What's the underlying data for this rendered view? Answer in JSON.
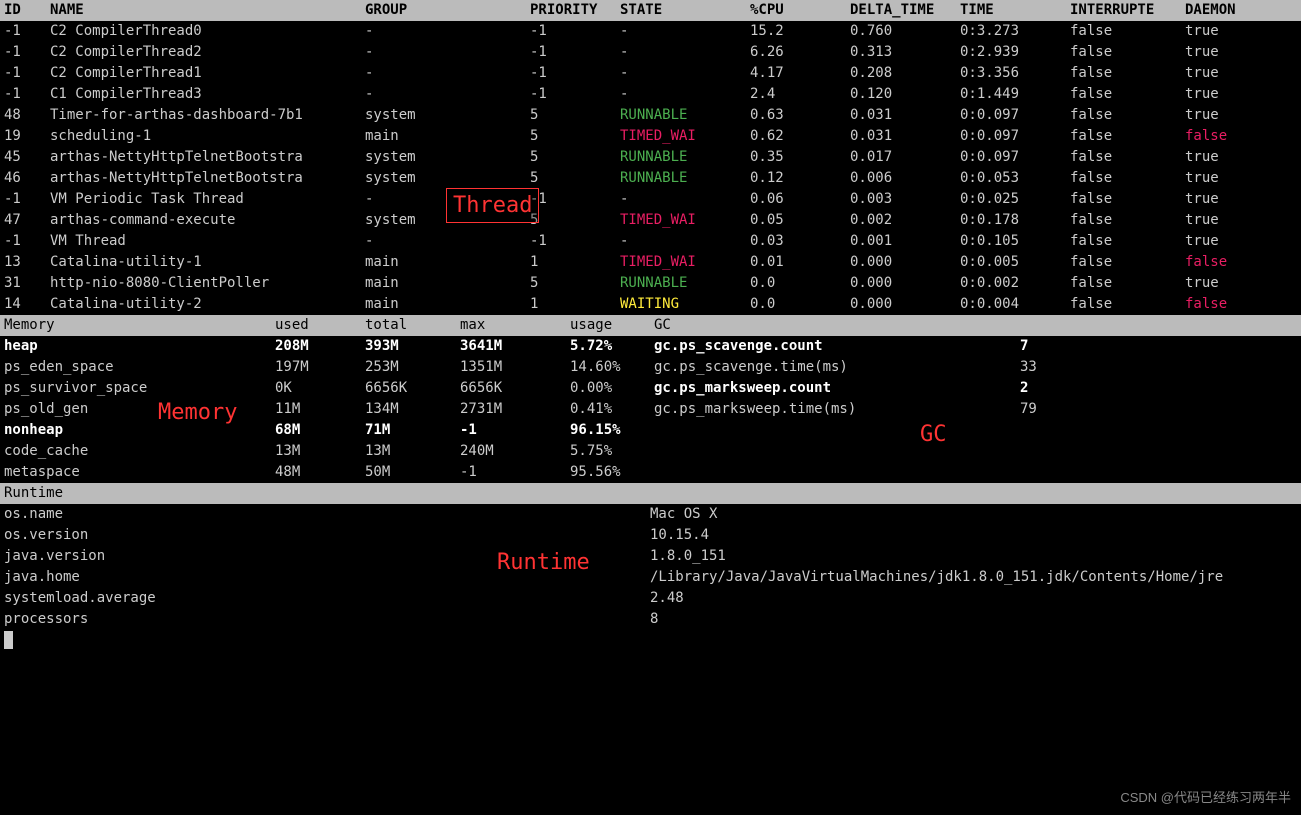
{
  "thread_headers": [
    "ID",
    "NAME",
    "GROUP",
    "PRIORITY",
    "STATE",
    "%CPU",
    "DELTA_TIME",
    "TIME",
    "INTERRUPTE",
    "DAEMON"
  ],
  "threads": [
    {
      "id": "-1",
      "name": "C2 CompilerThread0",
      "group": "-",
      "priority": "-1",
      "state": "-",
      "cpu": "15.2",
      "delta": "0.760",
      "time": "0:3.273",
      "interrupted": "false",
      "daemon": "true"
    },
    {
      "id": "-1",
      "name": "C2 CompilerThread2",
      "group": "-",
      "priority": "-1",
      "state": "-",
      "cpu": "6.26",
      "delta": "0.313",
      "time": "0:2.939",
      "interrupted": "false",
      "daemon": "true"
    },
    {
      "id": "-1",
      "name": "C2 CompilerThread1",
      "group": "-",
      "priority": "-1",
      "state": "-",
      "cpu": "4.17",
      "delta": "0.208",
      "time": "0:3.356",
      "interrupted": "false",
      "daemon": "true"
    },
    {
      "id": "-1",
      "name": "C1 CompilerThread3",
      "group": "-",
      "priority": "-1",
      "state": "-",
      "cpu": "2.4",
      "delta": "0.120",
      "time": "0:1.449",
      "interrupted": "false",
      "daemon": "true"
    },
    {
      "id": "48",
      "name": "Timer-for-arthas-dashboard-7b1",
      "group": "system",
      "priority": "5",
      "state": "RUNNABLE",
      "cpu": "0.63",
      "delta": "0.031",
      "time": "0:0.097",
      "interrupted": "false",
      "daemon": "true"
    },
    {
      "id": "19",
      "name": "scheduling-1",
      "group": "main",
      "priority": "5",
      "state": "TIMED_WAI",
      "cpu": "0.62",
      "delta": "0.031",
      "time": "0:0.097",
      "interrupted": "false",
      "daemon": "false"
    },
    {
      "id": "45",
      "name": "arthas-NettyHttpTelnetBootstra",
      "group": "system",
      "priority": "5",
      "state": "RUNNABLE",
      "cpu": "0.35",
      "delta": "0.017",
      "time": "0:0.097",
      "interrupted": "false",
      "daemon": "true"
    },
    {
      "id": "46",
      "name": "arthas-NettyHttpTelnetBootstra",
      "group": "system",
      "priority": "5",
      "state": "RUNNABLE",
      "cpu": "0.12",
      "delta": "0.006",
      "time": "0:0.053",
      "interrupted": "false",
      "daemon": "true"
    },
    {
      "id": "-1",
      "name": "VM Periodic Task Thread",
      "group": "-",
      "priority": "-1",
      "state": "-",
      "cpu": "0.06",
      "delta": "0.003",
      "time": "0:0.025",
      "interrupted": "false",
      "daemon": "true"
    },
    {
      "id": "47",
      "name": "arthas-command-execute",
      "group": "system",
      "priority": "5",
      "state": "TIMED_WAI",
      "cpu": "0.05",
      "delta": "0.002",
      "time": "0:0.178",
      "interrupted": "false",
      "daemon": "true"
    },
    {
      "id": "-1",
      "name": "VM Thread",
      "group": "-",
      "priority": "-1",
      "state": "-",
      "cpu": "0.03",
      "delta": "0.001",
      "time": "0:0.105",
      "interrupted": "false",
      "daemon": "true"
    },
    {
      "id": "13",
      "name": "Catalina-utility-1",
      "group": "main",
      "priority": "1",
      "state": "TIMED_WAI",
      "cpu": "0.01",
      "delta": "0.000",
      "time": "0:0.005",
      "interrupted": "false",
      "daemon": "false"
    },
    {
      "id": "31",
      "name": "http-nio-8080-ClientPoller",
      "group": "main",
      "priority": "5",
      "state": "RUNNABLE",
      "cpu": "0.0",
      "delta": "0.000",
      "time": "0:0.002",
      "interrupted": "false",
      "daemon": "true"
    },
    {
      "id": "14",
      "name": "Catalina-utility-2",
      "group": "main",
      "priority": "1",
      "state": "WAITING",
      "cpu": "0.0",
      "delta": "0.000",
      "time": "0:0.004",
      "interrupted": "false",
      "daemon": "false"
    }
  ],
  "memory_headers": {
    "section": "Memory",
    "used": "used",
    "total": "total",
    "max": "max",
    "usage": "usage"
  },
  "memory": [
    {
      "name": "heap",
      "used": "208M",
      "total": "393M",
      "max": "3641M",
      "usage": "5.72%",
      "bold": true
    },
    {
      "name": "ps_eden_space",
      "used": "197M",
      "total": "253M",
      "max": "1351M",
      "usage": "14.60%"
    },
    {
      "name": "ps_survivor_space",
      "used": "0K",
      "total": "6656K",
      "max": "6656K",
      "usage": "0.00%"
    },
    {
      "name": "ps_old_gen",
      "used": "11M",
      "total": "134M",
      "max": "2731M",
      "usage": "0.41%"
    },
    {
      "name": "nonheap",
      "used": "68M",
      "total": "71M",
      "max": "-1",
      "usage": "96.15%",
      "bold": true
    },
    {
      "name": "code_cache",
      "used": "13M",
      "total": "13M",
      "max": "240M",
      "usage": "5.75%"
    },
    {
      "name": "metaspace",
      "used": "48M",
      "total": "50M",
      "max": "-1",
      "usage": "95.56%"
    }
  ],
  "gc_header": "GC",
  "gc": [
    {
      "name": "gc.ps_scavenge.count",
      "val": "7",
      "bold": true
    },
    {
      "name": "gc.ps_scavenge.time(ms)",
      "val": "33"
    },
    {
      "name": "gc.ps_marksweep.count",
      "val": "2",
      "bold": true
    },
    {
      "name": "gc.ps_marksweep.time(ms)",
      "val": "79"
    }
  ],
  "runtime_header": "Runtime",
  "runtime": [
    {
      "key": "os.name",
      "val": "Mac OS X"
    },
    {
      "key": "os.version",
      "val": "10.15.4"
    },
    {
      "key": "java.version",
      "val": "1.8.0_151"
    },
    {
      "key": "java.home",
      "val": "/Library/Java/JavaVirtualMachines/jdk1.8.0_151.jdk/Contents/Home/jre"
    },
    {
      "key": "systemload.average",
      "val": "2.48"
    },
    {
      "key": "processors",
      "val": "8"
    }
  ],
  "annotations": {
    "thread": "Thread",
    "memory": "Memory",
    "gc": "GC",
    "runtime": "Runtime"
  },
  "watermark": "CSDN @代码已经练习两年半"
}
